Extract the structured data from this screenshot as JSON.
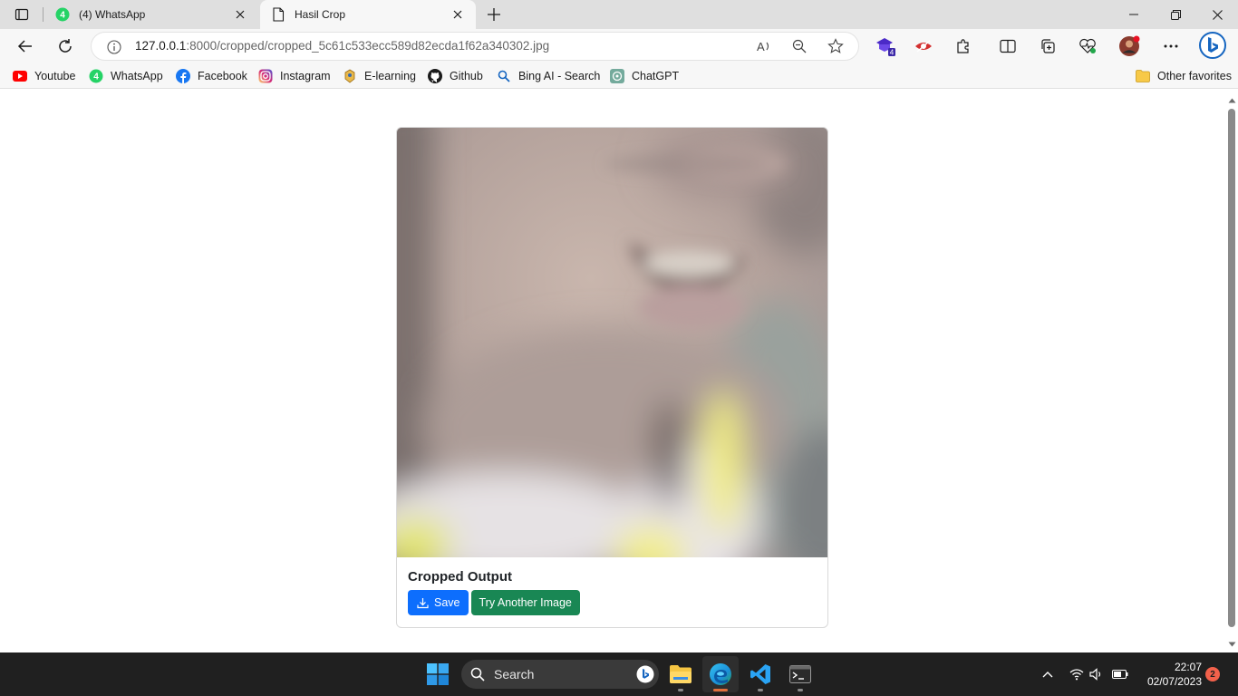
{
  "browser": {
    "tabs": [
      {
        "title": "(4) WhatsApp",
        "icon": "whatsapp-icon",
        "active": false
      },
      {
        "title": "Hasil Crop",
        "icon": "page-icon",
        "active": true
      }
    ],
    "address": {
      "host": "127.0.0.1",
      "path": ":8000/cropped/cropped_5c61c533ecc589d82ecda1f62a340302.jpg"
    },
    "extensions": {
      "badge_count": "4"
    },
    "favorites": [
      {
        "label": "Youtube",
        "icon": "youtube-icon"
      },
      {
        "label": "WhatsApp",
        "icon": "whatsapp-icon"
      },
      {
        "label": "Facebook",
        "icon": "facebook-icon"
      },
      {
        "label": "Instagram",
        "icon": "instagram-icon"
      },
      {
        "label": "E-learning",
        "icon": "e-learning-icon"
      },
      {
        "label": "Github",
        "icon": "github-icon"
      },
      {
        "label": "Bing AI - Search",
        "icon": "search-icon"
      },
      {
        "label": "ChatGPT",
        "icon": "chatgpt-icon"
      }
    ],
    "other_favorites": "Other favorites"
  },
  "card": {
    "title": "Cropped Output",
    "save_label": "Save",
    "try_again_label": "Try Another Image"
  },
  "colors": {
    "primary": "#0d6efd",
    "success": "#198754",
    "whatsapp": "#25d366",
    "taskbar": "#202020"
  },
  "taskbar": {
    "search_label": "Search",
    "time": "22:07",
    "date": "02/07/2023",
    "notifications": "2"
  }
}
